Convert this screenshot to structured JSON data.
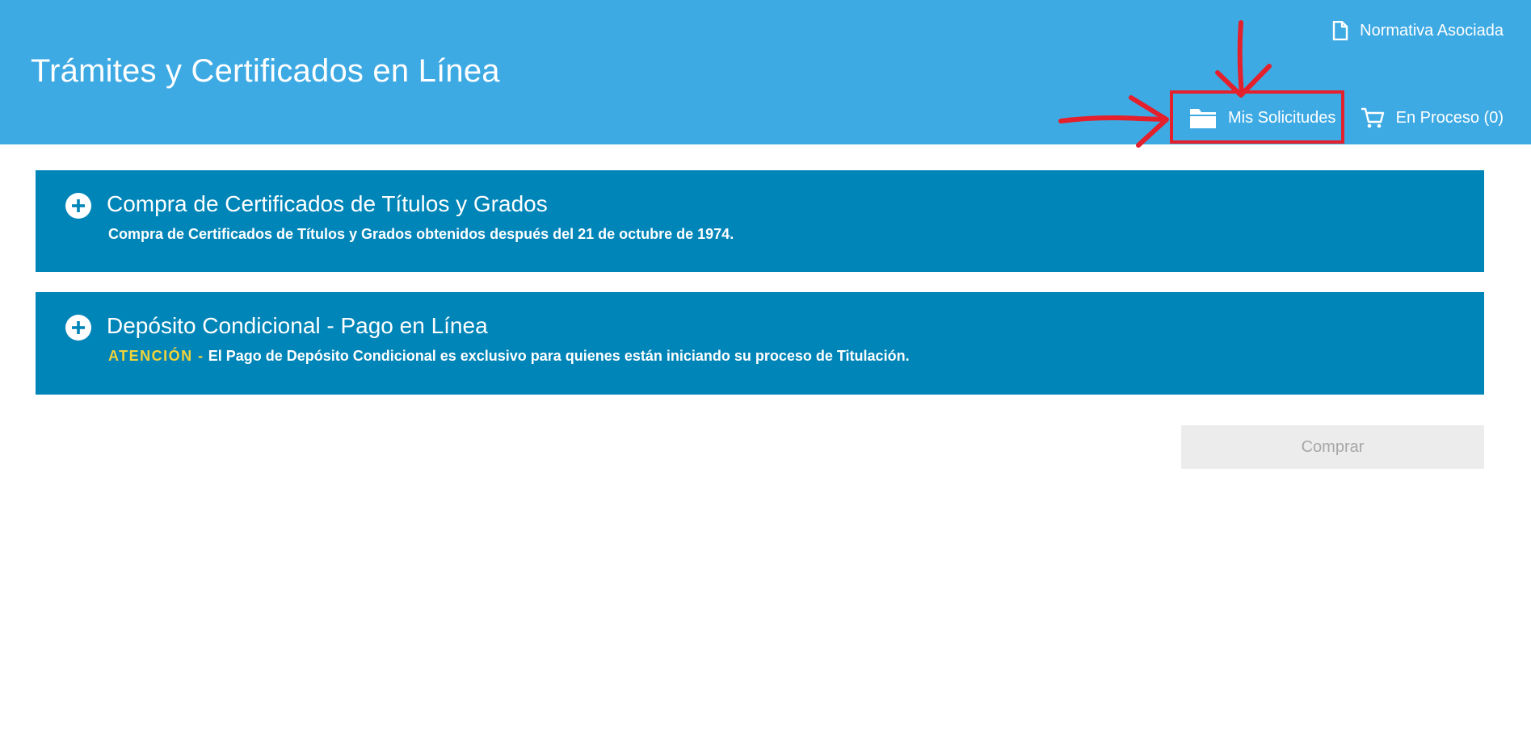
{
  "header": {
    "title": "Trámites y Certificados en Línea",
    "links": {
      "normativa": {
        "label": "Normativa Asociada",
        "icon": "document-icon"
      },
      "solicitudes": {
        "label": "Mis Solicitudes",
        "icon": "folder-icon"
      },
      "proceso": {
        "label": "En Proceso (0)",
        "icon": "cart-icon"
      }
    }
  },
  "panels": [
    {
      "title": "Compra de Certificados de Títulos y Grados",
      "description": "Compra de Certificados de Títulos y Grados obtenidos después del 21 de octubre de 1974.",
      "icon": "plus-circle-icon"
    },
    {
      "title": "Depósito Condicional - Pago en Línea",
      "warning_label": "ATENCIÓN -",
      "description": "El Pago de Depósito Condicional es exclusivo para quienes están iniciando su proceso de Titulación.",
      "icon": "plus-circle-icon"
    }
  ],
  "actions": {
    "buy_label": "Comprar",
    "buy_enabled": false
  },
  "colors": {
    "header_bg": "#3eaae4",
    "panel_bg": "#0085b8",
    "warning": "#f2d33a",
    "annotation": "#e3202c",
    "button_bg": "#ececec"
  }
}
